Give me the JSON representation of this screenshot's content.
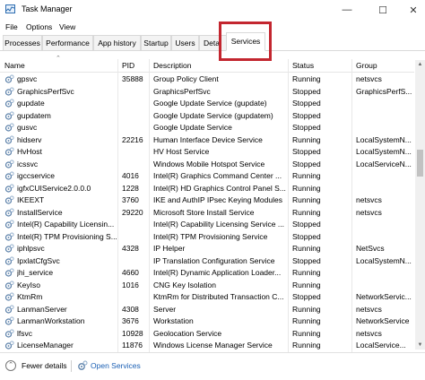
{
  "window": {
    "title": "Task Manager",
    "controls": {
      "minimize": "—",
      "maximize": "☐",
      "close": "✕"
    }
  },
  "menu": [
    "File",
    "Options",
    "View"
  ],
  "tabs": [
    "Processes",
    "Performance",
    "App history",
    "Startup",
    "Users",
    "Deta",
    "Services"
  ],
  "active_tab": "Services",
  "highlight_color": "#c3262f",
  "columns": [
    "Name",
    "PID",
    "Description",
    "Status",
    "Group"
  ],
  "rows": [
    {
      "name": "gpsvc",
      "pid": "35888",
      "desc": "Group Policy Client",
      "status": "Running",
      "group": "netsvcs"
    },
    {
      "name": "GraphicsPerfSvc",
      "pid": "",
      "desc": "GraphicsPerfSvc",
      "status": "Stopped",
      "group": "GraphicsPerfS..."
    },
    {
      "name": "gupdate",
      "pid": "",
      "desc": "Google Update Service (gupdate)",
      "status": "Stopped",
      "group": ""
    },
    {
      "name": "gupdatem",
      "pid": "",
      "desc": "Google Update Service (gupdatem)",
      "status": "Stopped",
      "group": ""
    },
    {
      "name": "gusvc",
      "pid": "",
      "desc": "Google Update Service",
      "status": "Stopped",
      "group": ""
    },
    {
      "name": "hidserv",
      "pid": "22216",
      "desc": "Human Interface Device Service",
      "status": "Running",
      "group": "LocalSystemN..."
    },
    {
      "name": "HvHost",
      "pid": "",
      "desc": "HV Host Service",
      "status": "Stopped",
      "group": "LocalSystemN..."
    },
    {
      "name": "icssvc",
      "pid": "",
      "desc": "Windows Mobile Hotspot Service",
      "status": "Stopped",
      "group": "LocalServiceN..."
    },
    {
      "name": "igccservice",
      "pid": "4016",
      "desc": "Intel(R) Graphics Command Center ...",
      "status": "Running",
      "group": ""
    },
    {
      "name": "igfxCUIService2.0.0.0",
      "pid": "1228",
      "desc": "Intel(R) HD Graphics Control Panel S...",
      "status": "Running",
      "group": ""
    },
    {
      "name": "IKEEXT",
      "pid": "3760",
      "desc": "IKE and AuthIP IPsec Keying Modules",
      "status": "Running",
      "group": "netsvcs"
    },
    {
      "name": "InstallService",
      "pid": "29220",
      "desc": "Microsoft Store Install Service",
      "status": "Running",
      "group": "netsvcs"
    },
    {
      "name": "Intel(R) Capability Licensin...",
      "pid": "",
      "desc": "Intel(R) Capability Licensing Service ...",
      "status": "Stopped",
      "group": ""
    },
    {
      "name": "Intel(R) TPM Provisioning S...",
      "pid": "",
      "desc": "Intel(R) TPM Provisioning Service",
      "status": "Stopped",
      "group": ""
    },
    {
      "name": "iphlpsvc",
      "pid": "4328",
      "desc": "IP Helper",
      "status": "Running",
      "group": "NetSvcs"
    },
    {
      "name": "IpxlatCfgSvc",
      "pid": "",
      "desc": "IP Translation Configuration Service",
      "status": "Stopped",
      "group": "LocalSystemN..."
    },
    {
      "name": "jhi_service",
      "pid": "4660",
      "desc": "Intel(R) Dynamic Application Loader...",
      "status": "Running",
      "group": ""
    },
    {
      "name": "KeyIso",
      "pid": "1016",
      "desc": "CNG Key Isolation",
      "status": "Running",
      "group": ""
    },
    {
      "name": "KtmRm",
      "pid": "",
      "desc": "KtmRm for Distributed Transaction C...",
      "status": "Stopped",
      "group": "NetworkServic..."
    },
    {
      "name": "LanmanServer",
      "pid": "4308",
      "desc": "Server",
      "status": "Running",
      "group": "netsvcs"
    },
    {
      "name": "LanmanWorkstation",
      "pid": "3676",
      "desc": "Workstation",
      "status": "Running",
      "group": "NetworkService"
    },
    {
      "name": "lfsvc",
      "pid": "10928",
      "desc": "Geolocation Service",
      "status": "Running",
      "group": "netsvcs"
    },
    {
      "name": "LicenseManager",
      "pid": "11876",
      "desc": "Windows License Manager Service",
      "status": "Running",
      "group": "LocalService..."
    }
  ],
  "footer": {
    "fewer_details": "Fewer details",
    "open_services": "Open Services"
  }
}
